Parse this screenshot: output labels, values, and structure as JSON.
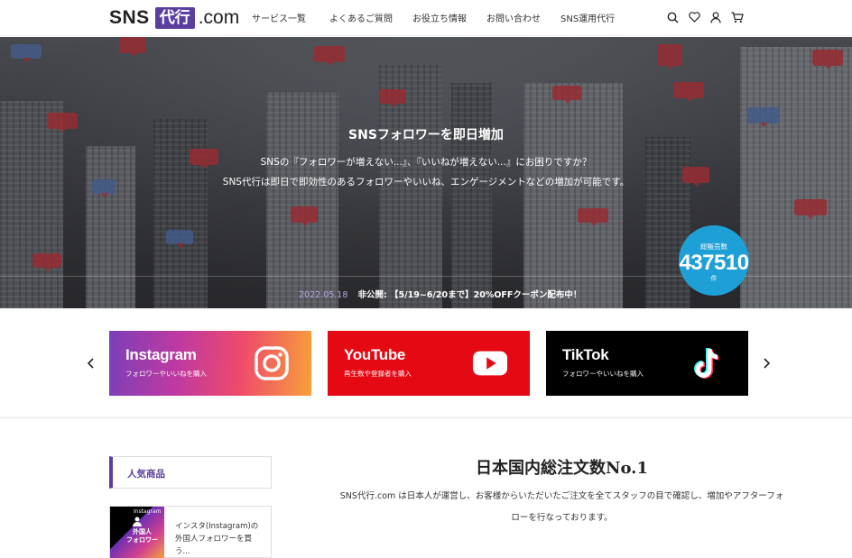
{
  "header": {
    "logo": {
      "sns": "SNS",
      "box": "代行",
      "dotcom": ".com"
    },
    "nav": [
      "サービス一覧",
      "よくあるご質問",
      "お役立ち情報",
      "お問い合わせ",
      "SNS運用代行"
    ],
    "icons": [
      "search-icon",
      "heart-icon",
      "user-icon",
      "cart-icon"
    ]
  },
  "hero": {
    "title": "SNSフォロワーを即日増加",
    "line1": "SNSの『フォロワーが増えない...』、『いいねが増えない...』にお困りですか？",
    "line2": "SNS代行は即日で即効性のあるフォロワーやいいね、エンゲージメントなどの増加が可能です。",
    "news": {
      "date": "2022.05.18",
      "text": "非公開: 【5/19~6/20まで】20%OFFクーポン配布中！"
    },
    "counter": {
      "label": "総販売数",
      "value": "437510",
      "unit": "件"
    }
  },
  "carousel": {
    "cards": [
      {
        "title": "Instagram",
        "subtitle": "フォロワーやいいねを購入"
      },
      {
        "title": "YouTube",
        "subtitle": "再生数や登録者を購入"
      },
      {
        "title": "TikTok",
        "subtitle": "フォロワーやいいねを購入"
      }
    ]
  },
  "sidebar": {
    "title": "人気商品",
    "product": {
      "thumb_top": "Instagram",
      "thumb_text": "外国人\nフォロワー",
      "name": "インスタ(Instagram)の外国人フォロワーを買う..."
    }
  },
  "main": {
    "heading": "日本国内総注文数No.1",
    "text1": "SNS代行.com は日本人が運営し、お客様からいただいたご注文を全てスタッフの目で確認し、増加やアフターフォ",
    "text2": "ローを行なっております。"
  },
  "colors": {
    "brand": "#5b3fa0",
    "counter": "#1ea0d6",
    "youtube": "#e50914",
    "tiktok": "#000000"
  }
}
